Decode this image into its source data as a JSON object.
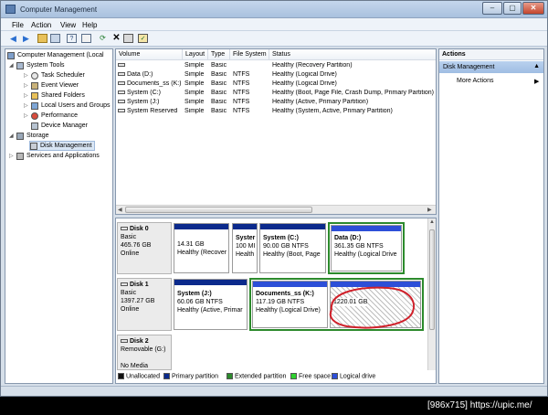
{
  "window": {
    "title": "Computer Management"
  },
  "menu": {
    "file": "File",
    "action": "Action",
    "view": "View",
    "help": "Help"
  },
  "tree": {
    "root": "Computer Management (Local",
    "system_tools": "System Tools",
    "task_scheduler": "Task Scheduler",
    "event_viewer": "Event Viewer",
    "shared_folders": "Shared Folders",
    "local_users": "Local Users and Groups",
    "performance": "Performance",
    "device_manager": "Device Manager",
    "storage": "Storage",
    "disk_management": "Disk Management",
    "services": "Services and Applications"
  },
  "volumes": {
    "headers": {
      "volume": "Volume",
      "layout": "Layout",
      "type": "Type",
      "fs": "File System",
      "status": "Status"
    },
    "rows": [
      {
        "volume": "",
        "layout": "Simple",
        "type": "Basic",
        "fs": "",
        "status": "Healthy (Recovery Partition)"
      },
      {
        "volume": "Data (D:)",
        "layout": "Simple",
        "type": "Basic",
        "fs": "NTFS",
        "status": "Healthy (Logical Drive)"
      },
      {
        "volume": "Documents_ss (K:)",
        "layout": "Simple",
        "type": "Basic",
        "fs": "NTFS",
        "status": "Healthy (Logical Drive)"
      },
      {
        "volume": "System (C:)",
        "layout": "Simple",
        "type": "Basic",
        "fs": "NTFS",
        "status": "Healthy (Boot, Page File, Crash Dump, Primary Partition)"
      },
      {
        "volume": "System (J:)",
        "layout": "Simple",
        "type": "Basic",
        "fs": "NTFS",
        "status": "Healthy (Active, Primary Partition)"
      },
      {
        "volume": "System Reserved",
        "layout": "Simple",
        "type": "Basic",
        "fs": "NTFS",
        "status": "Healthy (System, Active, Primary Partition)"
      }
    ]
  },
  "disks": {
    "disk0": {
      "name": "Disk 0",
      "kind": "Basic",
      "size": "465.76 GB",
      "state": "Online",
      "p1": {
        "line1": "14.31 GB",
        "line2": "Healthy (Recover"
      },
      "p2": {
        "name": "Syster",
        "line1": "100 MI",
        "line2": "Health"
      },
      "p3": {
        "name": "System (C:)",
        "line1": "90.00 GB NTFS",
        "line2": "Healthy (Boot, Page"
      },
      "p4": {
        "name": "Data (D:)",
        "line1": "361.35 GB NTFS",
        "line2": "Healthy (Logical Drive"
      }
    },
    "disk1": {
      "name": "Disk 1",
      "kind": "Basic",
      "size": "1397.27 GB",
      "state": "Online",
      "p1": {
        "name": "System (J:)",
        "line1": "60.06 GB NTFS",
        "line2": "Healthy (Active, Primar"
      },
      "p2": {
        "name": "Documents_ss (K:)",
        "line1": "117.19 GB NTFS",
        "line2": "Healthy (Logical Drive)"
      },
      "p3": {
        "line1": "1220.01 GB"
      }
    },
    "disk2": {
      "name": "Disk 2",
      "kind": "Removable (G:)",
      "media": "No Media"
    }
  },
  "legend": {
    "unallocated": "Unallocated",
    "primary": "Primary partition",
    "extended": "Extended partition",
    "free": "Free space",
    "logical": "Logical drive"
  },
  "actions": {
    "header": "Actions",
    "section": "Disk Management",
    "more": "More Actions"
  },
  "watermark": "[986x715]  https://upic.me/",
  "colors": {
    "primary": "#0b2a8c",
    "logical": "#2d4fd8",
    "extended": "#2c8a2c",
    "free": "#2fd12f",
    "unallocated": "#111111",
    "annotation": "#d0202a"
  }
}
